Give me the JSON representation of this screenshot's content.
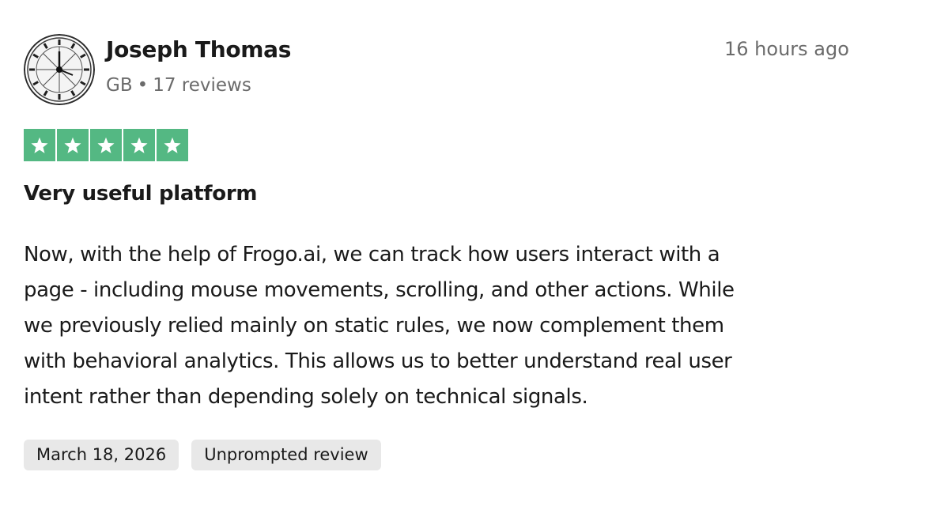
{
  "reviewer": {
    "name": "Joseph Thomas",
    "country": "GB",
    "separator": "•",
    "review_count": "17 reviews",
    "avatar_icon": "clock-avatar-icon"
  },
  "review": {
    "posted_ago": "16 hours ago",
    "rating": 5,
    "rating_max": 5,
    "star_color": "#54b883",
    "title": "Very useful platform",
    "body_lines": [
      "Now, with the help of Frogo.ai, we can track how users interact with a",
      "page - including mouse movements, scrolling, and other actions. While",
      "we previously relied mainly on static rules, we now complement them",
      "with behavioral analytics. This allows us to better understand real user",
      "intent rather than depending solely on technical signals."
    ],
    "tags": {
      "date": "March 18, 2026",
      "type": "Unprompted review"
    }
  }
}
